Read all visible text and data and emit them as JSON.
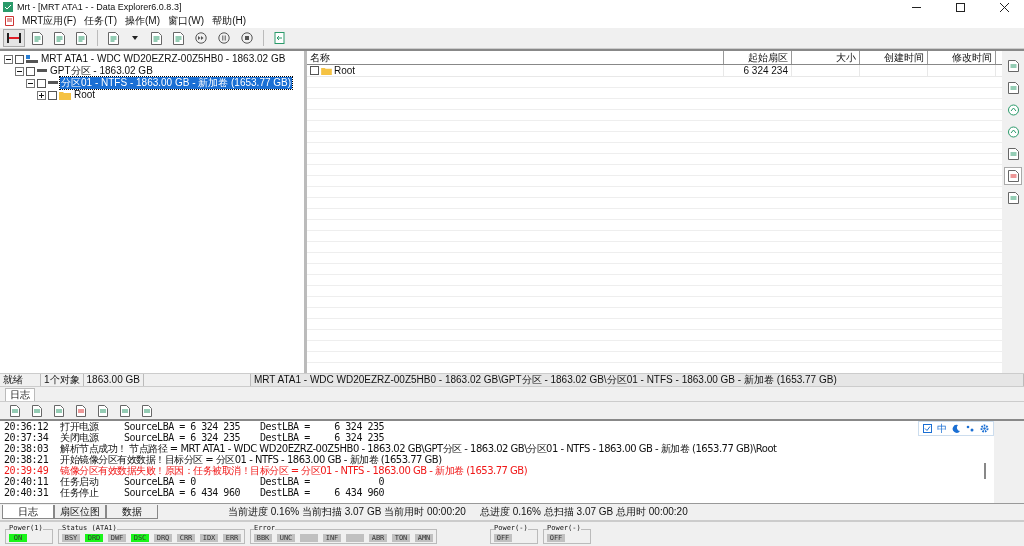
{
  "window": {
    "title": "Mrt - [MRT ATA1 -  - Data Explorer6.0.8.3]"
  },
  "menu": [
    "MRT应用(F)",
    "任务(T)",
    "操作(M)",
    "窗口(W)",
    "帮助(H)"
  ],
  "tree": [
    {
      "label": "MRT ATA1 - WDC WD20EZRZ-00Z5HB0 - 1863.02 GB",
      "kind": "disk",
      "expanded": true,
      "checked": false,
      "selected": false,
      "children": [
        {
          "label": "GPT分区 - 1863.02 GB",
          "kind": "drive",
          "expanded": true,
          "checked": false,
          "selected": false,
          "children": [
            {
              "label": "分区01 - NTFS - 1863.00 GB - 新加卷 (1653.77 GB)",
              "kind": "drive",
              "expanded": true,
              "checked": false,
              "selected": true,
              "children": [
                {
                  "label": "Root",
                  "kind": "folder",
                  "expanded": false,
                  "checked": false,
                  "selected": false
                }
              ]
            }
          ]
        }
      ]
    }
  ],
  "table": {
    "columns": [
      "名称",
      "起始扇区",
      "大小",
      "创建时间",
      "修改时间"
    ],
    "rows": [
      {
        "name": "Root",
        "start_sector": "6 324 234",
        "checked": false
      }
    ]
  },
  "status_bar": [
    "就绪",
    "1个对象",
    "1863.00 GB",
    "MRT ATA1 - WDC WD20EZRZ-00Z5HB0 - 1863.02 GB\\GPT分区 - 1863.02 GB\\分区01 - NTFS - 1863.00 GB - 新加卷 (1653.77 GB)"
  ],
  "log_tab": "日志",
  "log": [
    {
      "time": "20:36:12",
      "message": "打开电源",
      "source": "SourceLBA = 6 324 235",
      "dest_label": "DestLBA =",
      "dest_value": "6 324 235",
      "error": false
    },
    {
      "time": "20:37:34",
      "message": "关闭电源",
      "source": "SourceLBA = 6 324 235",
      "dest_label": "DestLBA =",
      "dest_value": "6 324 235",
      "error": false
    },
    {
      "time": "20:38:03",
      "message": "解析节点成功！ 节点路径 = MRT ATA1 - WDC WD20EZRZ-00Z5HB0 - 1863.02 GB\\GPT分区 - 1863.02 GB\\分区01 - NTFS - 1863.00 GB - 新加卷 (1653.77 GB)\\Root",
      "error": false
    },
    {
      "time": "20:38:21",
      "message": "开始镜像分区有效数据！目标分区 = 分区01 - NTFS - 1863.00 GB - 新加卷 (1653.77 GB)",
      "error": false
    },
    {
      "time": "20:39:49",
      "message": "镜像分区有效数据失败！原因：任务被取消！目标分区 = 分区01 - NTFS - 1863.00 GB - 新加卷 (1653.77 GB)",
      "error": true
    },
    {
      "time": "20:40:11",
      "message": "任务启动",
      "source": "SourceLBA = 0",
      "dest_label": "DestLBA =",
      "dest_value": "0",
      "error": false
    },
    {
      "time": "20:40:31",
      "message": "任务停止",
      "source": "SourceLBA = 6 434 960",
      "dest_label": "DestLBA =",
      "dest_value": "6 434 960",
      "error": false
    }
  ],
  "ime": {
    "label": "中"
  },
  "bottom_tabs": [
    {
      "label": "日志",
      "selected": true
    },
    {
      "label": "扇区位图",
      "selected": false
    },
    {
      "label": "数据",
      "selected": false
    }
  ],
  "progress_current": "当前进度 0.16% 当前扫描 3.07 GB 当前用时 00:00:20",
  "progress_total": "总进度 0.16% 总扫描 3.07 GB 总用时 00:00:20",
  "indicators": [
    {
      "title": "Power(1)",
      "lights": [
        {
          "label": "ON",
          "on": true
        }
      ]
    },
    {
      "title": "Status (ATA1)",
      "lights": [
        {
          "label": "BSY",
          "on": false
        },
        {
          "label": "DRD",
          "on": true
        },
        {
          "label": "DWF",
          "on": false
        },
        {
          "label": "DSC",
          "on": true
        },
        {
          "label": "DRQ",
          "on": false
        },
        {
          "label": "CRR",
          "on": false
        },
        {
          "label": "IDX",
          "on": false
        },
        {
          "label": "ERR",
          "on": false
        }
      ]
    },
    {
      "title": "Error",
      "lights": [
        {
          "label": "BBK",
          "on": false
        },
        {
          "label": "UNC",
          "on": false
        },
        {
          "on": false
        },
        {
          "label": "INF",
          "on": false
        },
        {
          "on": false
        },
        {
          "label": "ABR",
          "on": false
        },
        {
          "label": "TON",
          "on": false
        },
        {
          "label": "AMN",
          "on": false
        }
      ]
    },
    {
      "title": "Power(-)",
      "lights": [
        {
          "label": "OFF",
          "on": false
        }
      ]
    },
    {
      "title": "Power(-)",
      "lights": [
        {
          "label": "OFF",
          "on": false
        }
      ]
    }
  ]
}
